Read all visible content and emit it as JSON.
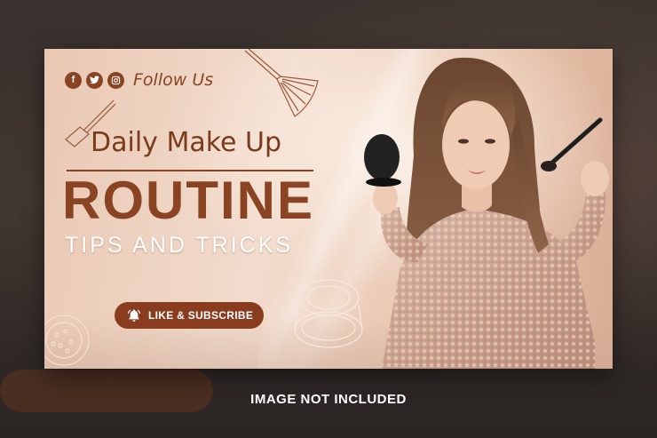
{
  "social": {
    "icons": [
      "facebook-icon",
      "twitter-icon",
      "instagram-icon"
    ],
    "follow_label": "Follow Us"
  },
  "headline": {
    "subtitle": "Daily Make Up",
    "title": "ROUTINE",
    "tagline": "TIPS AND TRICKS"
  },
  "cta": {
    "label": "LIKE & SUBSCRIBE",
    "icon": "bell-icon"
  },
  "caption": "IMAGE NOT INCLUDED",
  "colors": {
    "brand_brown": "#8a4424",
    "button": "#8a3c1e",
    "background_peach": "#f2dccd",
    "outer_background": "#2a2422"
  }
}
